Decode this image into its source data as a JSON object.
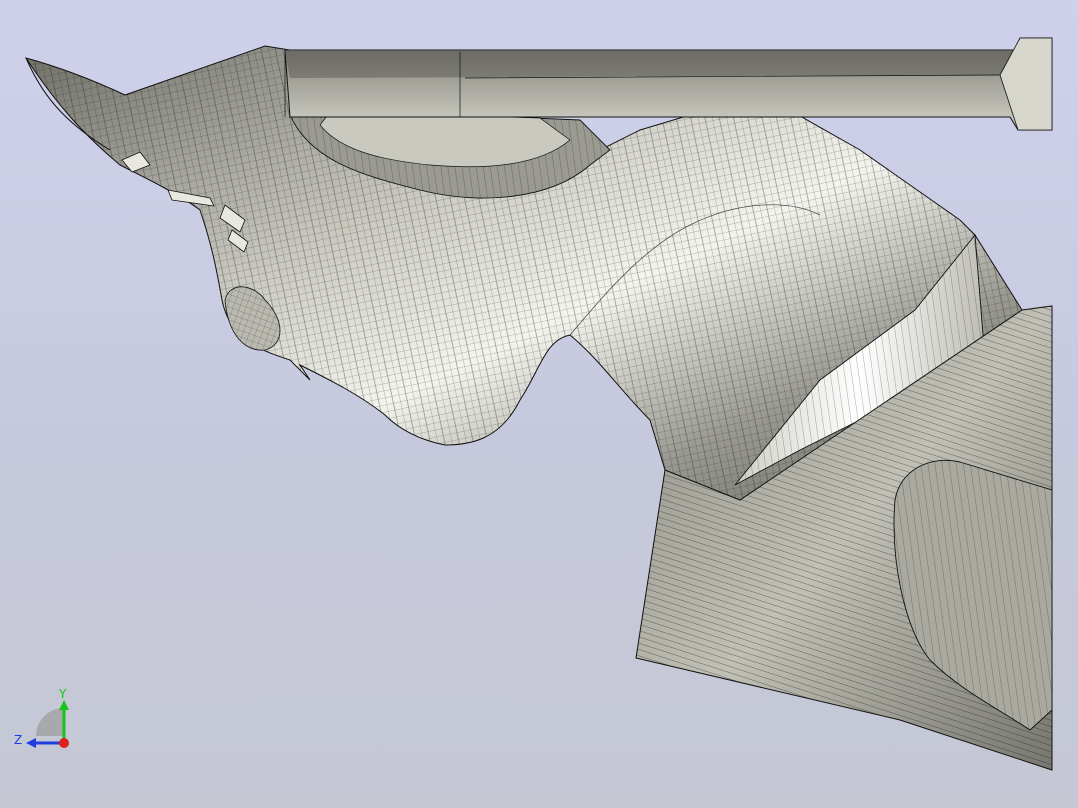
{
  "view": {
    "background_top": "#cfd1ec",
    "background_bottom": "#c5c8d3",
    "model_fill": "#d8d8d0",
    "model_shade": "#8e8e86",
    "mesh_edge_color": "#111111"
  },
  "triad": {
    "y_label": "Y",
    "z_label": "Z",
    "y_color": "#19c419",
    "z_color": "#1f3de0",
    "x_color": "#e0201a"
  }
}
